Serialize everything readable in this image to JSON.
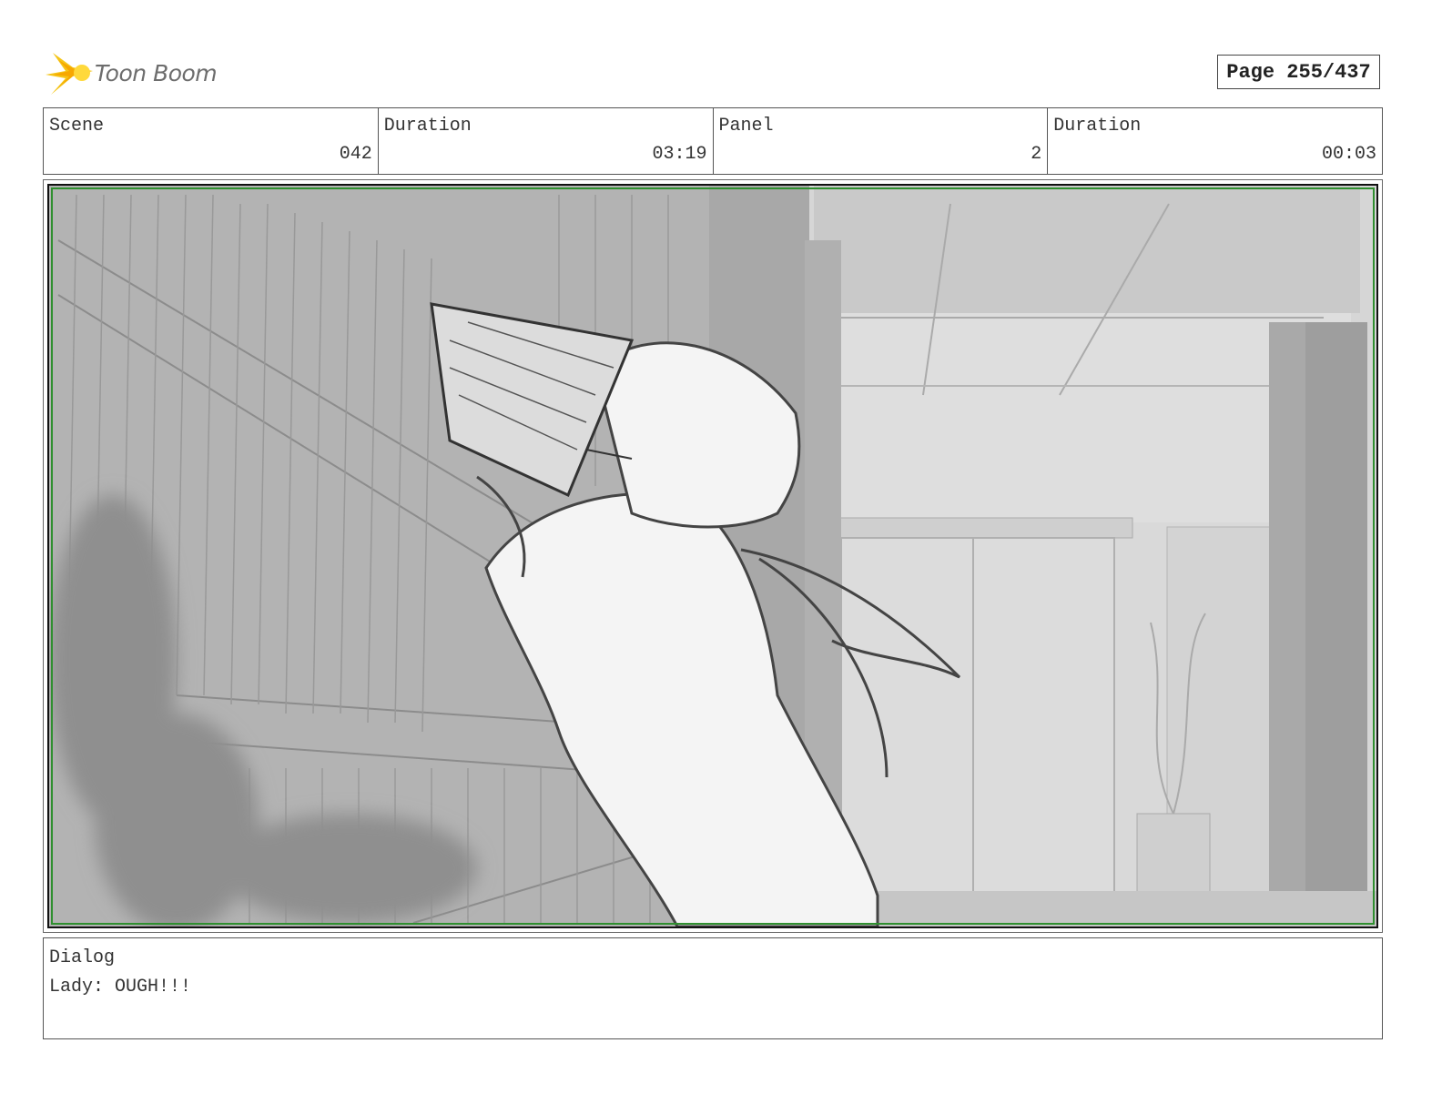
{
  "header": {
    "logo_text": "Toon Boom",
    "page_label": "Page 255/437"
  },
  "info": {
    "scene_label": "Scene",
    "scene_value": "042",
    "scene_duration_label": "Duration",
    "scene_duration_value": "03:19",
    "panel_label": "Panel",
    "panel_value": "2",
    "panel_duration_label": "Duration",
    "panel_duration_value": "00:03"
  },
  "dialog": {
    "label": "Dialog",
    "text": "Lady: OUGH!!!"
  },
  "colors": {
    "frame_border": "#2f8f2f",
    "logo_accent": "#f5c518"
  }
}
